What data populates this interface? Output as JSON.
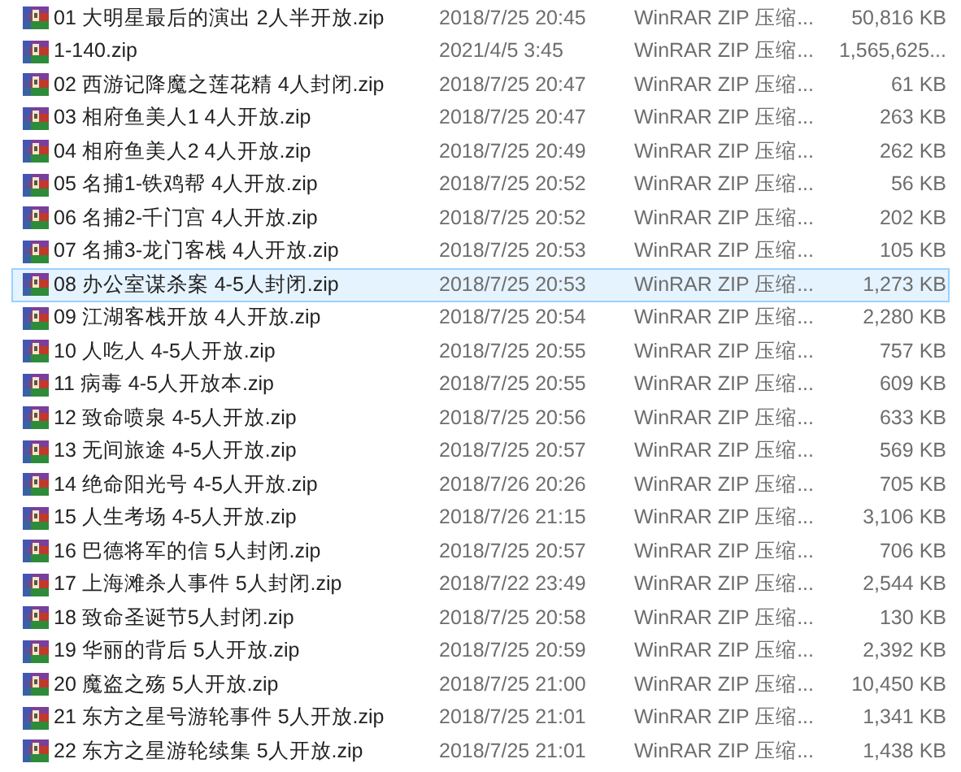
{
  "files": [
    {
      "name": "01 大明星最后的演出 2人半开放.zip",
      "date": "2018/7/25 20:45",
      "type": "WinRAR ZIP 压缩...",
      "size": "50,816 KB",
      "selected": false
    },
    {
      "name": "1-140.zip",
      "date": "2021/4/5 3:45",
      "type": "WinRAR ZIP 压缩...",
      "size": "1,565,625...",
      "selected": false
    },
    {
      "name": "02 西游记降魔之莲花精 4人封闭.zip",
      "date": "2018/7/25 20:47",
      "type": "WinRAR ZIP 压缩...",
      "size": "61 KB",
      "selected": false
    },
    {
      "name": "03 相府鱼美人1 4人开放.zip",
      "date": "2018/7/25 20:47",
      "type": "WinRAR ZIP 压缩...",
      "size": "263 KB",
      "selected": false
    },
    {
      "name": "04 相府鱼美人2 4人开放.zip",
      "date": "2018/7/25 20:49",
      "type": "WinRAR ZIP 压缩...",
      "size": "262 KB",
      "selected": false
    },
    {
      "name": "05 名捕1-铁鸡帮 4人开放.zip",
      "date": "2018/7/25 20:52",
      "type": "WinRAR ZIP 压缩...",
      "size": "56 KB",
      "selected": false
    },
    {
      "name": "06 名捕2-千门宫 4人开放.zip",
      "date": "2018/7/25 20:52",
      "type": "WinRAR ZIP 压缩...",
      "size": "202 KB",
      "selected": false
    },
    {
      "name": "07 名捕3-龙门客栈 4人开放.zip",
      "date": "2018/7/25 20:53",
      "type": "WinRAR ZIP 压缩...",
      "size": "105 KB",
      "selected": false
    },
    {
      "name": "08 办公室谋杀案 4-5人封闭.zip",
      "date": "2018/7/25 20:53",
      "type": "WinRAR ZIP 压缩...",
      "size": "1,273 KB",
      "selected": true
    },
    {
      "name": "09 江湖客栈开放 4人开放.zip",
      "date": "2018/7/25 20:54",
      "type": "WinRAR ZIP 压缩...",
      "size": "2,280 KB",
      "selected": false
    },
    {
      "name": "10 人吃人 4-5人开放.zip",
      "date": "2018/7/25 20:55",
      "type": "WinRAR ZIP 压缩...",
      "size": "757 KB",
      "selected": false
    },
    {
      "name": "11 病毒 4-5人开放本.zip",
      "date": "2018/7/25 20:55",
      "type": "WinRAR ZIP 压缩...",
      "size": "609 KB",
      "selected": false
    },
    {
      "name": "12 致命喷泉 4-5人开放.zip",
      "date": "2018/7/25 20:56",
      "type": "WinRAR ZIP 压缩...",
      "size": "633 KB",
      "selected": false
    },
    {
      "name": "13 无间旅途 4-5人开放.zip",
      "date": "2018/7/25 20:57",
      "type": "WinRAR ZIP 压缩...",
      "size": "569 KB",
      "selected": false
    },
    {
      "name": "14 绝命阳光号 4-5人开放.zip",
      "date": "2018/7/26 20:26",
      "type": "WinRAR ZIP 压缩...",
      "size": "705 KB",
      "selected": false
    },
    {
      "name": "15 人生考场 4-5人开放.zip",
      "date": "2018/7/26 21:15",
      "type": "WinRAR ZIP 压缩...",
      "size": "3,106 KB",
      "selected": false
    },
    {
      "name": "16 巴德将军的信 5人封闭.zip",
      "date": "2018/7/25 20:57",
      "type": "WinRAR ZIP 压缩...",
      "size": "706 KB",
      "selected": false
    },
    {
      "name": "17 上海滩杀人事件 5人封闭.zip",
      "date": "2018/7/22 23:49",
      "type": "WinRAR ZIP 压缩...",
      "size": "2,544 KB",
      "selected": false
    },
    {
      "name": "18 致命圣诞节5人封闭.zip",
      "date": "2018/7/25 20:58",
      "type": "WinRAR ZIP 压缩...",
      "size": "130 KB",
      "selected": false
    },
    {
      "name": "19 华丽的背后 5人开放.zip",
      "date": "2018/7/25 20:59",
      "type": "WinRAR ZIP 压缩...",
      "size": "2,392 KB",
      "selected": false
    },
    {
      "name": "20 魔盗之殇 5人开放.zip",
      "date": "2018/7/25 21:00",
      "type": "WinRAR ZIP 压缩...",
      "size": "10,450 KB",
      "selected": false
    },
    {
      "name": "21 东方之星号游轮事件 5人开放.zip",
      "date": "2018/7/25 21:01",
      "type": "WinRAR ZIP 压缩...",
      "size": "1,341 KB",
      "selected": false
    },
    {
      "name": "22 东方之星游轮续集 5人开放.zip",
      "date": "2018/7/25 21:01",
      "type": "WinRAR ZIP 压缩...",
      "size": "1,438 KB",
      "selected": false
    }
  ]
}
